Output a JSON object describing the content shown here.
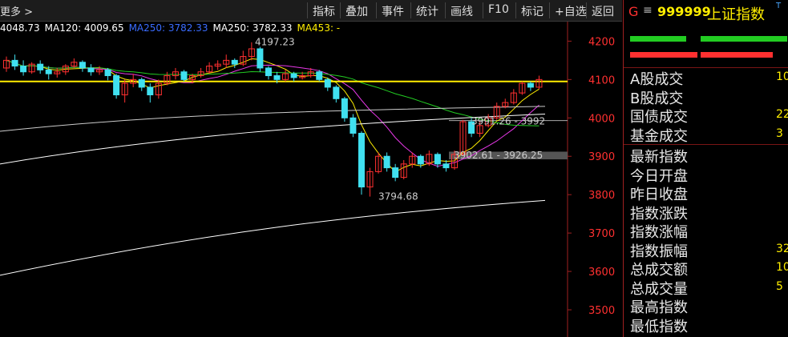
{
  "toolbar": {
    "more": "更多 >",
    "buttons": [
      "指标",
      "叠加",
      "事件",
      "统计",
      "画线",
      "F10",
      "标记",
      "+自选",
      "返回"
    ]
  },
  "ma_legend": [
    {
      "label": "4048.73",
      "color": "#ffffff"
    },
    {
      "label": "MA120: 4009.65",
      "color": "#ffffff"
    },
    {
      "label": "MA250: 3782.33",
      "color": "#3a6cff"
    },
    {
      "label": "MA250: 3782.33",
      "color": "#ffffff"
    },
    {
      "label": "MA453: -",
      "color": "#ffee00"
    }
  ],
  "chart_data": {
    "type": "candlestick",
    "ylim": [
      3450,
      4230
    ],
    "y_ticks": [
      4200,
      4100,
      4000,
      3900,
      3800,
      3700,
      3600,
      3500
    ],
    "y_tick_labels": [
      "4200",
      "4100",
      "4000",
      "3900",
      "3800",
      "3700",
      "3600",
      "3500"
    ],
    "horizontal_line": 4095,
    "annotations": [
      {
        "text": "4197.23",
        "value": 4197.23
      },
      {
        "text": "3794.68",
        "value": 3794.68
      },
      {
        "text": "3991.26 - 3992",
        "value": 3991.26
      },
      {
        "text": "3902.61 - 3926.25",
        "value": 3902.61
      }
    ],
    "candles": [
      [
        4130,
        4150,
        4160,
        4120
      ],
      [
        4150,
        4135,
        4165,
        4125
      ],
      [
        4135,
        4120,
        4150,
        4110
      ],
      [
        4120,
        4140,
        4145,
        4115
      ],
      [
        4140,
        4125,
        4150,
        4115
      ],
      [
        4125,
        4115,
        4135,
        4100
      ],
      [
        4115,
        4120,
        4130,
        4105
      ],
      [
        4120,
        4135,
        4140,
        4112
      ],
      [
        4135,
        4145,
        4155,
        4130
      ],
      [
        4145,
        4130,
        4150,
        4120
      ],
      [
        4130,
        4120,
        4140,
        4110
      ],
      [
        4120,
        4125,
        4135,
        4112
      ],
      [
        4125,
        4110,
        4130,
        4098
      ],
      [
        4110,
        4060,
        4115,
        4050
      ],
      [
        4060,
        4090,
        4100,
        4040
      ],
      [
        4090,
        4100,
        4115,
        4080
      ],
      [
        4100,
        4080,
        4105,
        4070
      ],
      [
        4080,
        4060,
        4090,
        4040
      ],
      [
        4060,
        4090,
        4100,
        4050
      ],
      [
        4090,
        4110,
        4120,
        4085
      ],
      [
        4110,
        4120,
        4130,
        4100
      ],
      [
        4120,
        4100,
        4125,
        4095
      ],
      [
        4100,
        4110,
        4115,
        4090
      ],
      [
        4110,
        4120,
        4130,
        4105
      ],
      [
        4120,
        4135,
        4145,
        4115
      ],
      [
        4135,
        4140,
        4150,
        4125
      ],
      [
        4140,
        4150,
        4165,
        4130
      ],
      [
        4150,
        4140,
        4155,
        4130
      ],
      [
        4140,
        4160,
        4175,
        4135
      ],
      [
        4160,
        4180,
        4197,
        4150
      ],
      [
        4180,
        4130,
        4185,
        4120
      ],
      [
        4130,
        4110,
        4135,
        4100
      ],
      [
        4110,
        4100,
        4120,
        4090
      ],
      [
        4100,
        4115,
        4125,
        4095
      ],
      [
        4115,
        4105,
        4120,
        4095
      ],
      [
        4105,
        4110,
        4120,
        4100
      ],
      [
        4110,
        4120,
        4130,
        4105
      ],
      [
        4120,
        4100,
        4125,
        4095
      ],
      [
        4100,
        4080,
        4105,
        4070
      ],
      [
        4080,
        4050,
        4085,
        4040
      ],
      [
        4050,
        4000,
        4055,
        3990
      ],
      [
        4000,
        3960,
        4010,
        3950
      ],
      [
        3960,
        3820,
        3965,
        3800
      ],
      [
        3820,
        3860,
        3870,
        3795
      ],
      [
        3860,
        3900,
        3910,
        3855
      ],
      [
        3900,
        3870,
        3910,
        3860
      ],
      [
        3870,
        3845,
        3880,
        3835
      ],
      [
        3845,
        3880,
        3890,
        3840
      ],
      [
        3880,
        3900,
        3910,
        3870
      ],
      [
        3900,
        3880,
        3905,
        3870
      ],
      [
        3880,
        3905,
        3915,
        3875
      ],
      [
        3905,
        3880,
        3910,
        3870
      ],
      [
        3880,
        3870,
        3890,
        3860
      ],
      [
        3870,
        3905,
        3915,
        3865
      ],
      [
        3905,
        3990,
        3995,
        3900
      ],
      [
        3990,
        3960,
        4000,
        3950
      ],
      [
        3960,
        3980,
        3990,
        3950
      ],
      [
        3980,
        4000,
        4010,
        3975
      ],
      [
        4000,
        4030,
        4040,
        3995
      ],
      [
        4030,
        4040,
        4050,
        4025
      ],
      [
        4040,
        4065,
        4075,
        4035
      ],
      [
        4065,
        4090,
        4095,
        4060
      ],
      [
        4090,
        4080,
        4095,
        4070
      ],
      [
        4080,
        4100,
        4110,
        4075
      ]
    ],
    "ma_lines": [
      {
        "color": "#ffee00"
      },
      {
        "color": "#e838e8"
      },
      {
        "color": "#22cc22"
      },
      {
        "color": "#cccccc"
      },
      {
        "color": "#ffffff"
      }
    ]
  },
  "right_panel": {
    "code": "999999",
    "name": "上证指数",
    "menu": "≡",
    "g": "G",
    "t": "T",
    "bars": [
      {
        "color": "#22cc22"
      },
      {
        "color": "#22cc22"
      },
      {
        "color": "#ff3030"
      },
      {
        "color": "#ff3030"
      }
    ],
    "stats_top": [
      {
        "label": "A股成交",
        "value": "10"
      },
      {
        "label": "B股成交",
        "value": ""
      },
      {
        "label": "国债成交",
        "value": "22"
      },
      {
        "label": "基金成交",
        "value": "3"
      }
    ],
    "stats_bottom": [
      {
        "label": "最新指数",
        "value": ""
      },
      {
        "label": "今日开盘",
        "value": ""
      },
      {
        "label": "昨日收盘",
        "value": ""
      },
      {
        "label": "指数涨跌",
        "value": ""
      },
      {
        "label": "指数涨幅",
        "value": ""
      },
      {
        "label": "指数振幅",
        "value": "32"
      },
      {
        "label": "总成交额",
        "value": "10"
      },
      {
        "label": "总成交量",
        "value": "5"
      },
      {
        "label": "最高指数",
        "value": ""
      },
      {
        "label": "最低指数",
        "value": ""
      }
    ]
  }
}
